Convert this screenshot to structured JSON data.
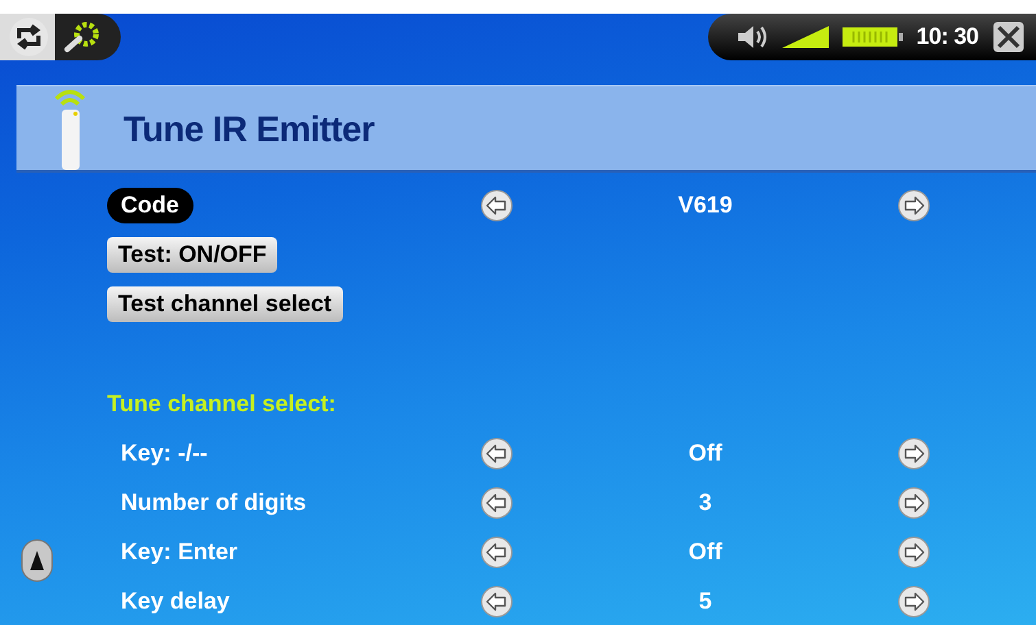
{
  "status_bar": {
    "time": "10: 30"
  },
  "header": {
    "title": "Tune IR Emitter"
  },
  "rows": [
    {
      "kind": "option",
      "label": "Code",
      "value": "V619",
      "selected": true
    },
    {
      "kind": "button",
      "label": "Test: ON/OFF"
    },
    {
      "kind": "button",
      "label": "Test channel select"
    },
    {
      "kind": "heading",
      "label": "Tune channel select:"
    },
    {
      "kind": "option",
      "label": "Key: -/--",
      "value": "Off",
      "selected": false
    },
    {
      "kind": "option",
      "label": "Number of digits",
      "value": "3",
      "selected": false
    },
    {
      "kind": "option",
      "label": "Key: Enter",
      "value": "Off",
      "selected": false
    },
    {
      "kind": "option",
      "label": "Key delay",
      "value": "5",
      "selected": false
    }
  ]
}
